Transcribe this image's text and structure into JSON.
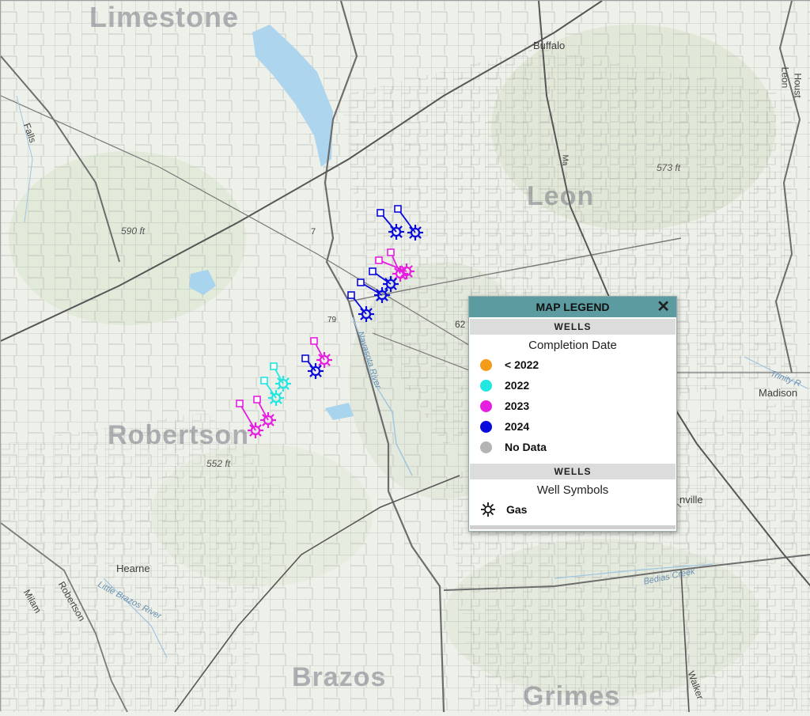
{
  "map": {
    "county_labels": [
      "Limestone",
      "Leon",
      "Robertson",
      "Brazos",
      "Grimes"
    ],
    "town_labels": [
      "Buffalo",
      "Hearne",
      "Madison",
      "nville"
    ],
    "elevation_labels": [
      "590 ft",
      "573 ft",
      "552 ft"
    ],
    "river_labels": [
      "Navasota River",
      "Little Brazos River",
      "Bedias Creek",
      "Trinity R"
    ],
    "road_labels": [
      "Falls",
      "Robertson",
      "Milam",
      "Walker",
      "Houst",
      "Leon",
      "62",
      "7",
      "79",
      "Ma"
    ],
    "colors": {
      "lt2022": "#f39c1a",
      "y2022": "#22e6e0",
      "y2023": "#e61ee0",
      "y2024": "#0a0adc",
      "nodata": "#b4b4b4",
      "header": "#5c9ba0"
    }
  },
  "legend": {
    "title": "MAP LEGEND",
    "close_icon": "close-icon",
    "section1_title": "WELLS",
    "section1_subtitle": "Completion Date",
    "items": [
      {
        "label": "< 2022",
        "color": "#f39c1a"
      },
      {
        "label": "2022",
        "color": "#22e6e0"
      },
      {
        "label": "2023",
        "color": "#e61ee0"
      },
      {
        "label": "2024",
        "color": "#0a0adc"
      },
      {
        "label": "No Data",
        "color": "#b4b4b4"
      }
    ],
    "section2_title": "WELLS",
    "section2_subtitle": "Well Symbols",
    "symbol_label": "Gas",
    "symbol_icon": "gas-well-icon"
  }
}
